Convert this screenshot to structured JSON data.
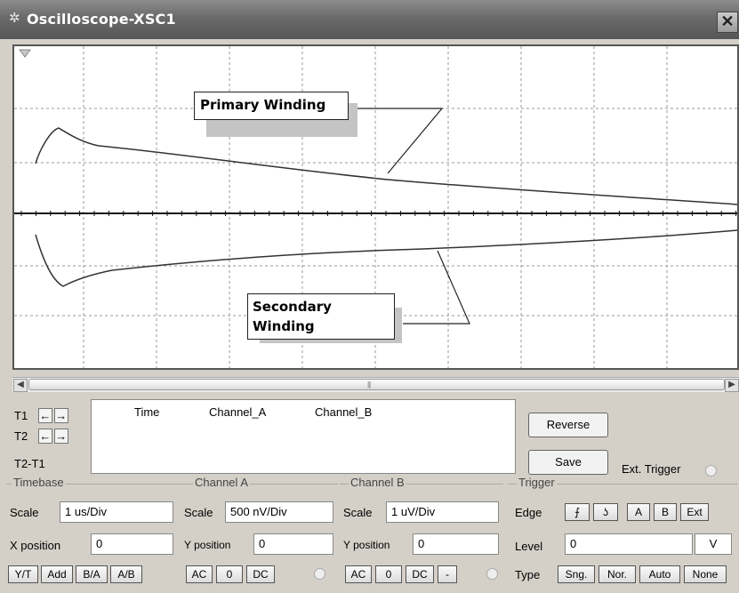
{
  "window": {
    "title": "Oscilloscope-XSC1",
    "close_glyph": "✕",
    "icon": "oscilloscope-icon"
  },
  "screen": {
    "annotations": {
      "primary": "Primary Winding",
      "secondary_line1": "Secondary",
      "secondary_line2": "Winding"
    }
  },
  "cursors": {
    "t1": "T1",
    "t2": "T2",
    "t2_t1": "T2-T1",
    "arrow_left": "←",
    "arrow_right": "→"
  },
  "readout": {
    "headers": [
      "Time",
      "Channel_A",
      "Channel_B"
    ]
  },
  "buttons": {
    "reverse": "Reverse",
    "save": "Save",
    "ext_trigger": "Ext. Trigger"
  },
  "timebase": {
    "title": "Timebase",
    "scale_label": "Scale",
    "scale_value": "1 us/Div",
    "xpos_label": "X position",
    "xpos_value": "0",
    "modes": [
      "Y/T",
      "Add",
      "B/A",
      "A/B"
    ]
  },
  "channel_a": {
    "title": "Channel A",
    "scale_label": "Scale",
    "scale_value": "500 nV/Div",
    "ypos_label": "Y position",
    "ypos_value": "0",
    "coupling": [
      "AC",
      "0",
      "DC"
    ]
  },
  "channel_b": {
    "title": "Channel B",
    "scale_label": "Scale",
    "scale_value": "1 uV/Div",
    "ypos_label": "Y position",
    "ypos_value": "0",
    "coupling": [
      "AC",
      "0",
      "DC",
      "-"
    ]
  },
  "trigger": {
    "title": "Trigger",
    "edge_label": "Edge",
    "edge_rise": "⨍",
    "edge_fall": "ʖ",
    "sources": [
      "A",
      "B",
      "Ext"
    ],
    "level_label": "Level",
    "level_value": "0",
    "level_unit": "V",
    "type_label": "Type",
    "types": [
      "Sng.",
      "Nor.",
      "Auto",
      "None"
    ]
  }
}
